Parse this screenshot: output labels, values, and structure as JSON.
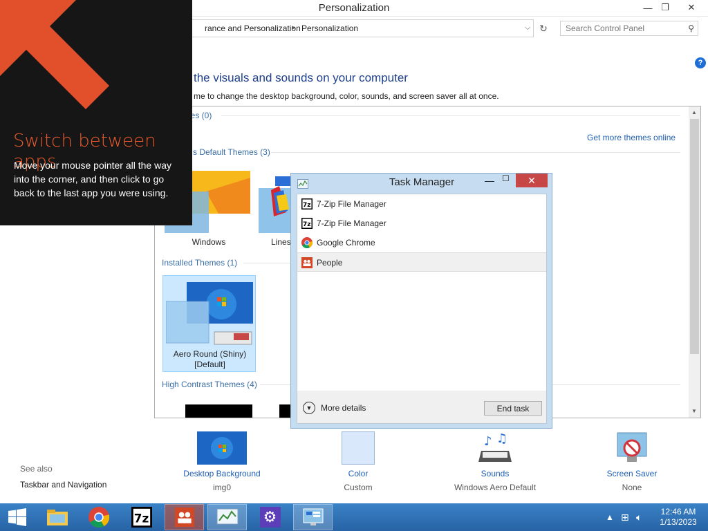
{
  "window": {
    "title": "Personalization",
    "controls": {
      "minimize": "—",
      "maximize": "❐",
      "close": "✕"
    }
  },
  "address": {
    "crumbs": [
      "rance and Personalization",
      "Personalization"
    ],
    "search_placeholder": "Search Control Panel"
  },
  "main": {
    "heading": "the visuals and sounds on your computer",
    "subtext": "me to change the desktop background, color, sounds, and screen saver all at once.",
    "get_more": "Get more themes online",
    "sections": {
      "my_themes": "nes (0)",
      "default_themes": "s Default Themes (3)",
      "installed_themes": "Installed Themes (1)",
      "high_contrast": "High Contrast Themes (4)"
    },
    "themes": {
      "windows": "Windows",
      "lines": "Lines",
      "aero_round": "Aero Round (Shiny)",
      "aero_round_default": "[Default]"
    }
  },
  "bottom": {
    "see_also": "See also",
    "see_also_link": "Taskbar and Navigation",
    "items": [
      {
        "label": "Desktop Background",
        "value": "img0"
      },
      {
        "label": "Color",
        "value": "Custom"
      },
      {
        "label": "Sounds",
        "value": "Windows Aero Default"
      },
      {
        "label": "Screen Saver",
        "value": "None"
      }
    ]
  },
  "overlay": {
    "title": "Switch between apps",
    "body": "Move your mouse pointer all the way into the corner, and then click to go back to the last app you were using."
  },
  "task_manager": {
    "title": "Task Manager",
    "rows": [
      {
        "label": "7-Zip File Manager",
        "icon": "7zip-icon"
      },
      {
        "label": "7-Zip File Manager",
        "icon": "7zip-icon"
      },
      {
        "label": "Google Chrome",
        "icon": "chrome-icon"
      },
      {
        "label": "People",
        "icon": "people-icon"
      }
    ],
    "more_details": "More details",
    "end_task": "End task"
  },
  "taskbar": {
    "time": "12:46 AM",
    "date": "1/13/2023"
  },
  "colors": {
    "accent_orange": "#e85a2c",
    "link_blue": "#1f5fb3",
    "taskbar_blue": "#2f72b8"
  }
}
